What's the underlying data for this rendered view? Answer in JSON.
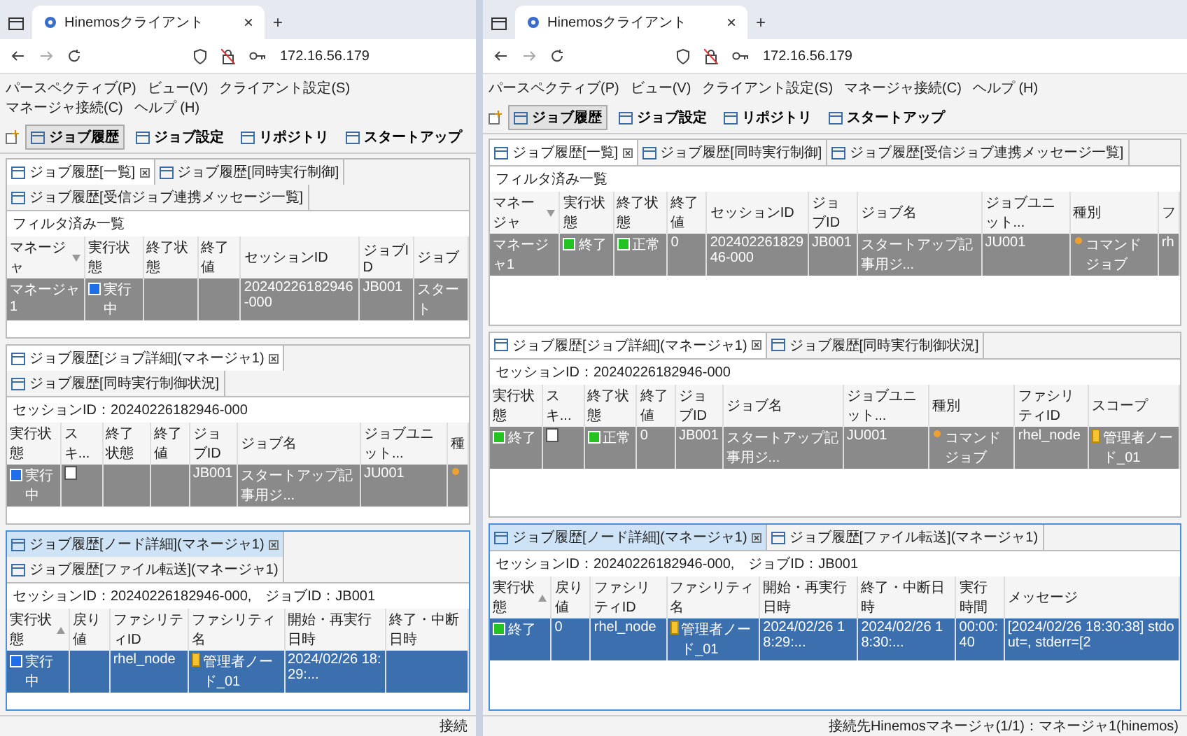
{
  "windows": [
    {
      "browser_tab": {
        "title": "Hinemosクライアント",
        "close": "×"
      },
      "new_tab": "+",
      "url": "172.16.56.179",
      "menu": [
        "パースペクティブ(P)",
        "ビュー(V)",
        "クライアント設定(S)",
        "マネージャ接続(C)",
        "ヘルプ (H)"
      ],
      "perspectives": [
        {
          "label": "ジョブ履歴",
          "selected": true
        },
        {
          "label": "ジョブ設定",
          "selected": false
        },
        {
          "label": "リポジトリ",
          "selected": false
        },
        {
          "label": "スタートアップ",
          "selected": false
        }
      ],
      "panels": [
        {
          "active": false,
          "tabs": [
            {
              "label": "ジョブ履歴[一覧]",
              "selected": true
            },
            {
              "label": "ジョブ履歴[同時実行制御]",
              "selected": false
            },
            {
              "label": "ジョブ履歴[受信ジョブ連携メッセージ一覧]",
              "selected": false
            }
          ],
          "info": "フィルタ済み一覧",
          "columns": [
            {
              "label": "マネージャ",
              "sort_descending": true
            },
            {
              "label": "実行状態"
            },
            {
              "label": "終了状態"
            },
            {
              "label": "終了値"
            },
            {
              "label": "セッションID"
            },
            {
              "label": "ジョブID"
            },
            {
              "label": "ジョブ"
            }
          ],
          "rows": [
            {
              "selected": true,
              "cells": [
                "マネージャ1",
                {
                  "kind": "status",
                  "text": "実行中",
                  "color": "#1e6fe8"
                },
                null,
                null,
                "20240226182946-000",
                "JB001",
                "スタート"
              ]
            }
          ]
        },
        {
          "active": false,
          "tabs": [
            {
              "label": "ジョブ履歴[ジョブ詳細](マネージャ1)",
              "selected": true
            },
            {
              "label": "ジョブ履歴[同時実行制御状況]",
              "selected": false
            }
          ],
          "info": "セッションID：20240226182946-000",
          "columns": [
            {
              "label": "実行状態"
            },
            {
              "label": "スキ..."
            },
            {
              "label": "終了状態"
            },
            {
              "label": "終了値"
            },
            {
              "label": "ジョブID"
            },
            {
              "label": "ジョブ名"
            },
            {
              "label": "ジョブユニット..."
            },
            {
              "label": "種"
            }
          ],
          "rows": [
            {
              "selected": true,
              "cells": [
                {
                  "kind": "status",
                  "text": "実行中",
                  "color": "#1e6fe8"
                },
                {
                  "kind": "checkbox",
                  "checked": false
                },
                null,
                null,
                "JB001",
                "スタートアップ記事用ジ...",
                "JU001",
                {
                  "kind": "jobtype"
                }
              ]
            }
          ]
        },
        {
          "active": true,
          "tabs": [
            {
              "label": "ジョブ履歴[ノード詳細](マネージャ1)",
              "selected": true
            },
            {
              "label": "ジョブ履歴[ファイル転送](マネージャ1)",
              "selected": false
            }
          ],
          "info": "セッションID：20240226182946-000,　ジョブID：JB001",
          "columns": [
            {
              "label": "実行状態",
              "sort_ascending": true
            },
            {
              "label": "戻り値"
            },
            {
              "label": "ファシリティID"
            },
            {
              "label": "ファシリティ名"
            },
            {
              "label": "開始・再実行日時"
            },
            {
              "label": "終了・中断日時"
            }
          ],
          "rows": [
            {
              "selected": true,
              "cells": [
                {
                  "kind": "status",
                  "text": "実行中",
                  "color": "#1e6fe8"
                },
                null,
                "rhel_node",
                {
                  "kind": "scope",
                  "text": "管理者ノード_01"
                },
                "2024/02/26 18:29:...",
                null
              ]
            }
          ]
        }
      ],
      "status_bar": "接続"
    },
    {
      "browser_tab": {
        "title": "Hinemosクライアント",
        "close": "×"
      },
      "new_tab": "+",
      "url": "172.16.56.179",
      "menu": [
        "パースペクティブ(P)",
        "ビュー(V)",
        "クライアント設定(S)",
        "マネージャ接続(C)",
        "ヘルプ (H)"
      ],
      "perspectives": [
        {
          "label": "ジョブ履歴",
          "selected": true
        },
        {
          "label": "ジョブ設定",
          "selected": false
        },
        {
          "label": "リポジトリ",
          "selected": false
        },
        {
          "label": "スタートアップ",
          "selected": false
        }
      ],
      "panels": [
        {
          "active": false,
          "tabs": [
            {
              "label": "ジョブ履歴[一覧]",
              "selected": true
            },
            {
              "label": "ジョブ履歴[同時実行制御]",
              "selected": false
            },
            {
              "label": "ジョブ履歴[受信ジョブ連携メッセージ一覧]",
              "selected": false
            }
          ],
          "info": "フィルタ済み一覧",
          "columns": [
            {
              "label": "マネージャ",
              "sort_descending": true
            },
            {
              "label": "実行状態"
            },
            {
              "label": "終了状態"
            },
            {
              "label": "終了値"
            },
            {
              "label": "セッションID"
            },
            {
              "label": "ジョブID"
            },
            {
              "label": "ジョブ名"
            },
            {
              "label": "ジョブユニット..."
            },
            {
              "label": "種別"
            },
            {
              "label": "フ"
            }
          ],
          "rows": [
            {
              "selected": true,
              "cells": [
                "マネージャ1",
                {
                  "kind": "status",
                  "text": "終了",
                  "color": "#22c322"
                },
                {
                  "kind": "status",
                  "text": "正常",
                  "color": "#22c322"
                },
                "0",
                "20240226182946-000",
                "JB001",
                "スタートアップ記事用ジ...",
                "JU001",
                {
                  "kind": "jobtype",
                  "text": "コマンドジョブ"
                },
                "rh"
              ]
            }
          ]
        },
        {
          "active": false,
          "tabs": [
            {
              "label": "ジョブ履歴[ジョブ詳細](マネージャ1)",
              "selected": true
            },
            {
              "label": "ジョブ履歴[同時実行制御状況]",
              "selected": false
            }
          ],
          "info": "セッションID：20240226182946-000",
          "columns": [
            {
              "label": "実行状態"
            },
            {
              "label": "スキ..."
            },
            {
              "label": "終了状態"
            },
            {
              "label": "終了値"
            },
            {
              "label": "ジョブID"
            },
            {
              "label": "ジョブ名"
            },
            {
              "label": "ジョブユニット..."
            },
            {
              "label": "種別"
            },
            {
              "label": "ファシリティID"
            },
            {
              "label": "スコープ"
            }
          ],
          "rows": [
            {
              "selected": true,
              "cells": [
                {
                  "kind": "status",
                  "text": "終了",
                  "color": "#22c322"
                },
                {
                  "kind": "checkbox",
                  "checked": false
                },
                {
                  "kind": "status",
                  "text": "正常",
                  "color": "#22c322"
                },
                "0",
                "JB001",
                "スタートアップ記事用ジ...",
                "JU001",
                {
                  "kind": "jobtype",
                  "text": "コマンドジョブ"
                },
                "rhel_node",
                {
                  "kind": "scope",
                  "text": "管理者ノード_01"
                }
              ]
            }
          ]
        },
        {
          "active": true,
          "tabs": [
            {
              "label": "ジョブ履歴[ノード詳細](マネージャ1)",
              "selected": true
            },
            {
              "label": "ジョブ履歴[ファイル転送](マネージャ1)",
              "selected": false
            }
          ],
          "info": "セッションID：20240226182946-000,　ジョブID：JB001",
          "columns": [
            {
              "label": "実行状態",
              "sort_ascending": true
            },
            {
              "label": "戻り値"
            },
            {
              "label": "ファシリティID"
            },
            {
              "label": "ファシリティ名"
            },
            {
              "label": "開始・再実行日時"
            },
            {
              "label": "終了・中断日時"
            },
            {
              "label": "実行時間"
            },
            {
              "label": "メッセージ"
            }
          ],
          "rows": [
            {
              "selected": true,
              "cells": [
                {
                  "kind": "status",
                  "text": "終了",
                  "color": "#22c322"
                },
                "0",
                "rhel_node",
                {
                  "kind": "scope",
                  "text": "管理者ノード_01"
                },
                "2024/02/26 18:29:...",
                "2024/02/26 18:30:...",
                "00:00:40",
                "[2024/02/26 18:30:38] stdout=, stderr=[2"
              ]
            }
          ]
        }
      ],
      "status_bar": "接続先Hinemosマネージャ(1/1)：マネージャ1(hinemos)"
    }
  ]
}
